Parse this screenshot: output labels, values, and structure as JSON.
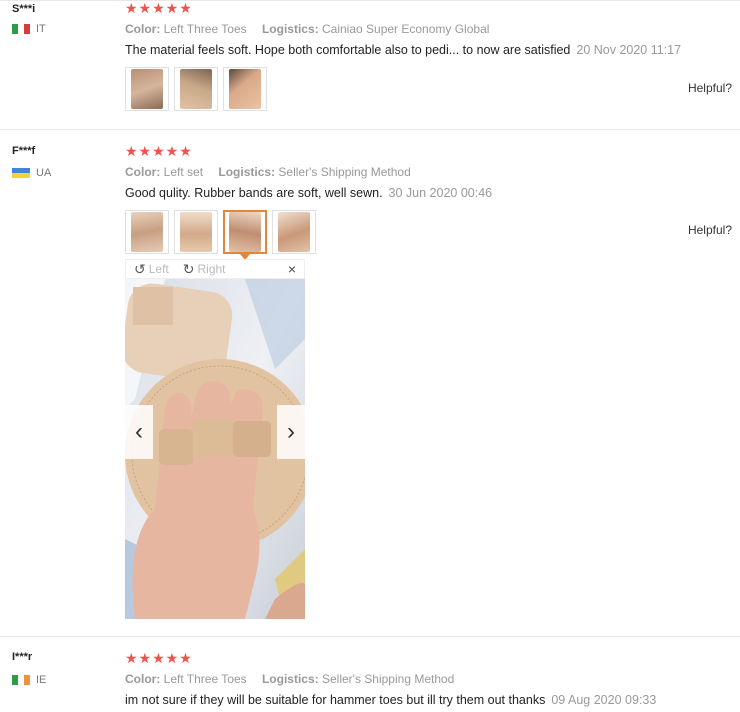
{
  "reviews": [
    {
      "user": "S***i",
      "country": "IT",
      "color_label": "Color:",
      "color_value": "Left Three Toes",
      "logistics_label": "Logistics:",
      "logistics_value": "Cainiao Super Economy Global",
      "stars": "★★★★★",
      "text": "The material feels soft. Hope both comfortable also to pedi... to now are satisfied",
      "date": "20 Nov 2020 11:17",
      "helpful": "Helpful?"
    },
    {
      "user": "F***f",
      "country": "UA",
      "color_label": "Color:",
      "color_value": "Left set",
      "logistics_label": "Logistics:",
      "logistics_value": "Seller's Shipping Method",
      "stars": "★★★★★",
      "text": "Good qulity. Rubber bands are soft, well sewn.",
      "date": "30 Jun 2020 00:46",
      "helpful": "Helpful?"
    },
    {
      "user": "I***r",
      "country": "IE",
      "color_label": "Color:",
      "color_value": "Left Three Toes",
      "logistics_label": "Logistics:",
      "logistics_value": "Seller's Shipping Method",
      "stars": "★★★★★",
      "text": "im not sure if they will be suitable for hammer toes but ill try them out thanks",
      "date": "09 Aug 2020 09:33",
      "helpful": "Helpful?"
    }
  ],
  "viewer": {
    "rotate_left_icon": "↺",
    "left_label": "Left",
    "rotate_right_icon": "↻",
    "right_label": "Right",
    "close_icon": "×",
    "prev_icon": "‹",
    "next_icon": "›"
  },
  "colors": {
    "star": "#f0524d",
    "active_border": "#e4853c",
    "muted_text": "#999999"
  }
}
